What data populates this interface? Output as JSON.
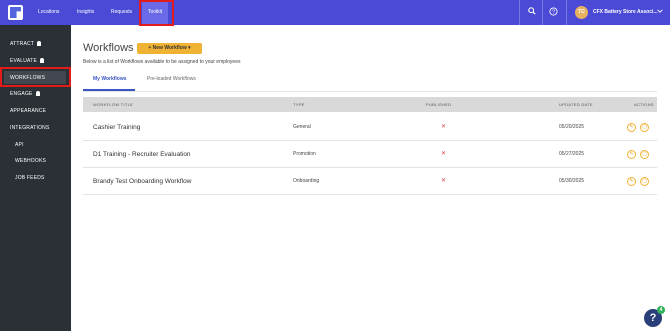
{
  "topnav": {
    "items": [
      {
        "label": "Locations"
      },
      {
        "label": "Insights"
      },
      {
        "label": "Requests"
      },
      {
        "label": "Toolkit"
      }
    ],
    "active_index": 3
  },
  "account": {
    "initials": "TC",
    "name": "CFX Battery Store Associ..."
  },
  "sidebar": {
    "items": [
      {
        "label": "ATTRACT"
      },
      {
        "label": "EVALUATE"
      },
      {
        "label": "WORKFLOWS"
      },
      {
        "label": "ENGAGE"
      },
      {
        "label": "APPEARANCE"
      },
      {
        "label": "INTEGRATIONS"
      },
      {
        "label": "API"
      },
      {
        "label": "WEBHOOKS"
      },
      {
        "label": "JOB FEEDS"
      }
    ],
    "active_index": 2
  },
  "main": {
    "title": "Workflows",
    "new_button": "+ New Workflow ▾",
    "subtitle": "Below is a list of Workflows available to be assigned to your employees",
    "tabs": [
      {
        "label": "My Workflows"
      },
      {
        "label": "Pre-loaded Workflows"
      }
    ],
    "active_tab": 0
  },
  "table": {
    "columns": [
      "WORKFLOW TITLE",
      "TYPE",
      "PUBLISHED",
      "UPDATED DATE",
      "ACTIONS"
    ],
    "rows": [
      {
        "title": "Cashier Training",
        "type": "General",
        "published": "✕",
        "updated": "05/20/2025"
      },
      {
        "title": "D1 Training - Recruiter Evaluation",
        "type": "Promotion",
        "published": "✕",
        "updated": "05/27/2025"
      },
      {
        "title": "Brandy Test Onboarding Workflow",
        "type": "Onboarding",
        "published": "✕",
        "updated": "05/30/2025"
      }
    ]
  },
  "help": {
    "label": "?",
    "badge": "4"
  },
  "icons": {
    "search": "search-icon",
    "help": "help-circle-icon",
    "chevron": "chevron-down-icon",
    "edit": "pencil-icon",
    "delete": "trash-icon"
  },
  "colors": {
    "topbar": "#4a4ad6",
    "sidebar": "#2b2f36",
    "accent": "#f0b232",
    "highlight": "#e21b1b",
    "tab_active": "#3a55c2"
  }
}
